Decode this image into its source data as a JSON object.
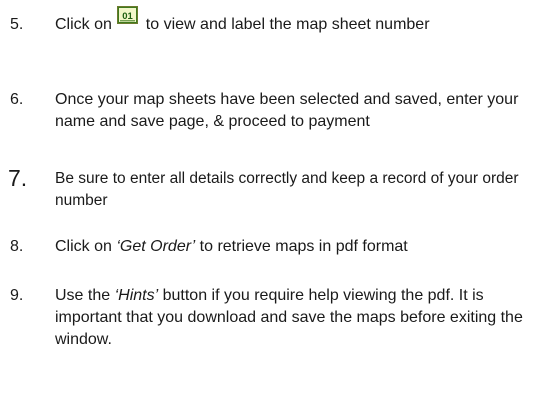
{
  "steps": [
    {
      "number": "5.",
      "before_icon": "Click on ",
      "icon": "map-sheet-number-icon",
      "icon_label": "01",
      "after_icon": " to view and label the map sheet number"
    },
    {
      "number": "6.",
      "text": "Once your map sheets have been selected and saved, enter your name and save page, & proceed to payment"
    },
    {
      "number": "7.",
      "text": "Be sure to enter all details correctly and keep a record of  your order number"
    },
    {
      "number": "8.",
      "before": "Click on ",
      "emphasis": "‘Get Order’",
      "after": " to retrieve maps in pdf format"
    },
    {
      "number": "9.",
      "before": "Use the ",
      "emphasis": "‘Hints’",
      "after": " button if you require help viewing the pdf. It is important that you download and save the maps before exiting the window."
    }
  ]
}
